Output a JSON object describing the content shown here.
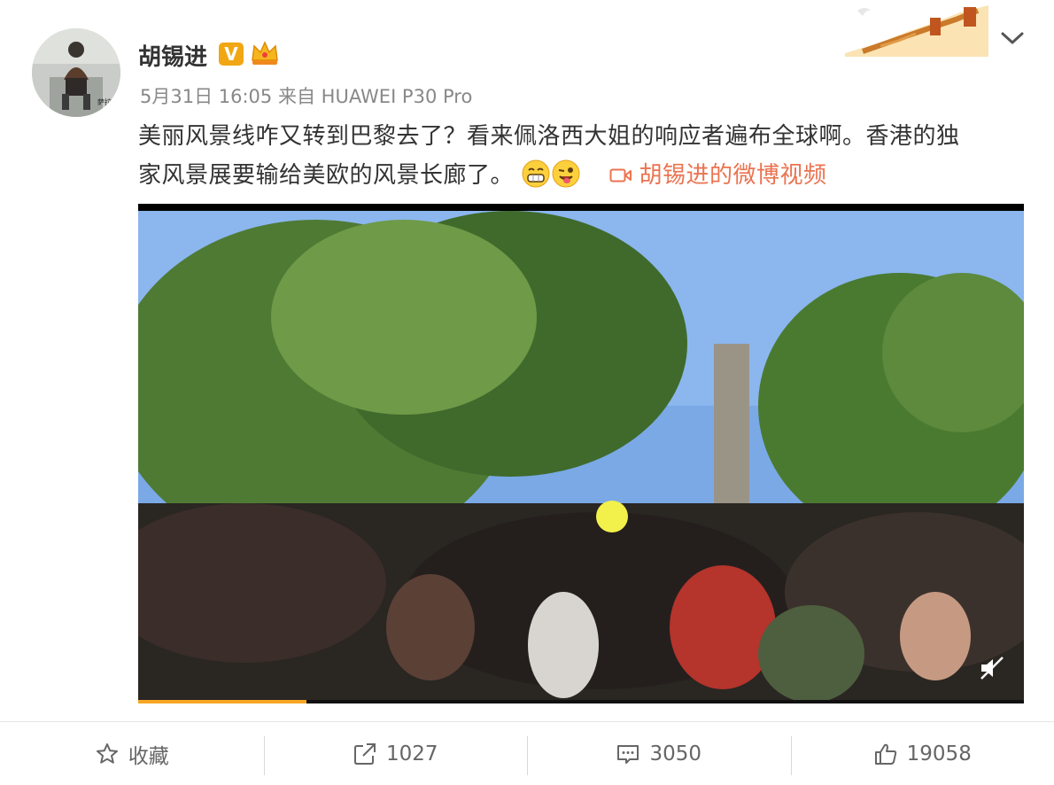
{
  "author": {
    "name": "胡锡进",
    "verified_badge": "V",
    "avatar_caption": "萨拉热窝 1995"
  },
  "post": {
    "date": "5月31日 16:05",
    "source_prefix": "来自",
    "device": "HUAWEI P30 Pro",
    "text_line1": "美丽风景线咋又转到巴黎去了？看来佩洛西大姐的响应者遍布全球啊。香港的独",
    "text_line2": "家风景展要输给美欧的风景长廊了。",
    "video_link": "胡锡进的微博视频"
  },
  "video": {
    "progress": 0.19
  },
  "actions": {
    "favorite_label": "收藏",
    "repost_count": "1027",
    "comment_count": "3050",
    "like_count": "19058"
  },
  "colors": {
    "accent_orange": "#eb7350",
    "verified_gold": "#f0a713",
    "progress": "#f6a623"
  },
  "icons": [
    "crown-icon",
    "chevron-down-icon",
    "grin-emoji-icon",
    "wink-emoji-icon",
    "video-icon",
    "mute-icon",
    "star-icon",
    "repost-icon",
    "comment-icon",
    "like-icon"
  ]
}
